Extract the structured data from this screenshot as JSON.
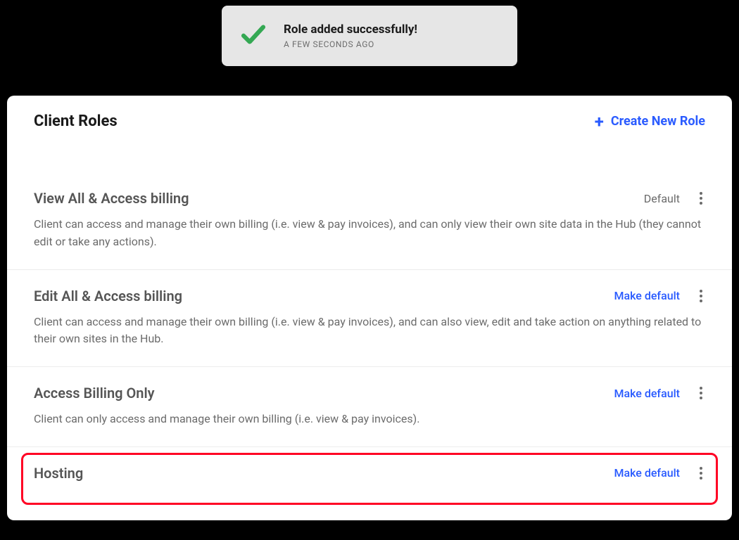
{
  "toast": {
    "title": "Role added successfully!",
    "subtitle": "A FEW SECONDS AGO"
  },
  "header": {
    "title": "Client Roles",
    "create_button_label": "Create New Role"
  },
  "labels": {
    "default_badge": "Default",
    "make_default": "Make default"
  },
  "roles": [
    {
      "name": "View All & Access billing",
      "description": "Client can access and manage their own billing (i.e. view & pay invoices), and can only view their own site data in the Hub (they cannot edit or take any actions).",
      "is_default": true
    },
    {
      "name": "Edit All & Access billing",
      "description": "Client can access and manage their own billing (i.e. view & pay invoices), and can also view, edit and take action on anything related to their own sites in the Hub.",
      "is_default": false
    },
    {
      "name": "Access Billing Only",
      "description": "Client can only access and manage their own billing (i.e. view & pay invoices).",
      "is_default": false
    },
    {
      "name": "Hosting",
      "description": "",
      "is_default": false
    }
  ]
}
